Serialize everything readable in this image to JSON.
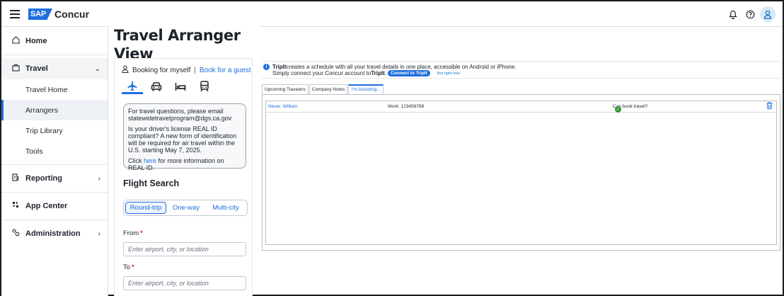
{
  "header": {
    "brand_box": "SAP",
    "brand_name": "Concur",
    "icons": [
      "menu-icon",
      "bell-icon",
      "help-icon",
      "user-icon"
    ]
  },
  "sidebar": {
    "items": [
      {
        "label": "Home",
        "icon": "home-icon"
      },
      {
        "label": "Travel",
        "icon": "briefcase-icon",
        "chevron": "⌄"
      },
      {
        "label": "Travel Home"
      },
      {
        "label": "Arrangers"
      },
      {
        "label": "Trip Library"
      },
      {
        "label": "Tools"
      },
      {
        "label": "Reporting",
        "icon": "reporting-icon",
        "chevron": "›"
      },
      {
        "label": "App Center",
        "icon": "app-center-icon"
      },
      {
        "label": "Administration",
        "icon": "admin-icon",
        "chevron": "›"
      }
    ]
  },
  "page": {
    "title": "Travel Arranger View"
  },
  "booking": {
    "for_myself": "Booking for myself",
    "separator": "|",
    "for_guest": "Book for a guest",
    "modes": [
      "flight-icon",
      "car-icon",
      "hotel-icon",
      "rail-icon"
    ],
    "info": {
      "line1": "For travel questions, please email statewidetravelprogram@dgs.ca.gov",
      "line2": "Is your driver's license REAL ID compliant? A new form of identification will be required for air travel within the U.S. starting May 7, 2025.",
      "line3_pre": "Click ",
      "line3_link": "here",
      "line3_post": " for more information on REAL ID."
    },
    "flight_search_title": "Flight Search",
    "trip_types": [
      "Round-trip",
      "One-way",
      "Multi-city"
    ],
    "from_label": "From",
    "from_placeholder": "Enter airport, city, or location",
    "to_label": "To",
    "to_placeholder": "Enter airport, city, or location",
    "required_mark": "*"
  },
  "tripit": {
    "brand": "TripIt",
    "text1": " creates a schedule with all your travel details in one place, accessible on Android or iPhone.",
    "text2_pre": "Simply connect your Concur account to ",
    "text2_brand": "TripIt",
    "text2_post": ".",
    "connect_label": "Connect to TripIt",
    "not_right_now": "Not right now"
  },
  "tabs": [
    "Upcoming Travelers",
    "Company Notes",
    "I'm Assisting..."
  ],
  "assisting": {
    "rows": [
      {
        "name": "Never, William",
        "work": "Work: 123456789",
        "can_book": "Can book travel?"
      }
    ]
  }
}
